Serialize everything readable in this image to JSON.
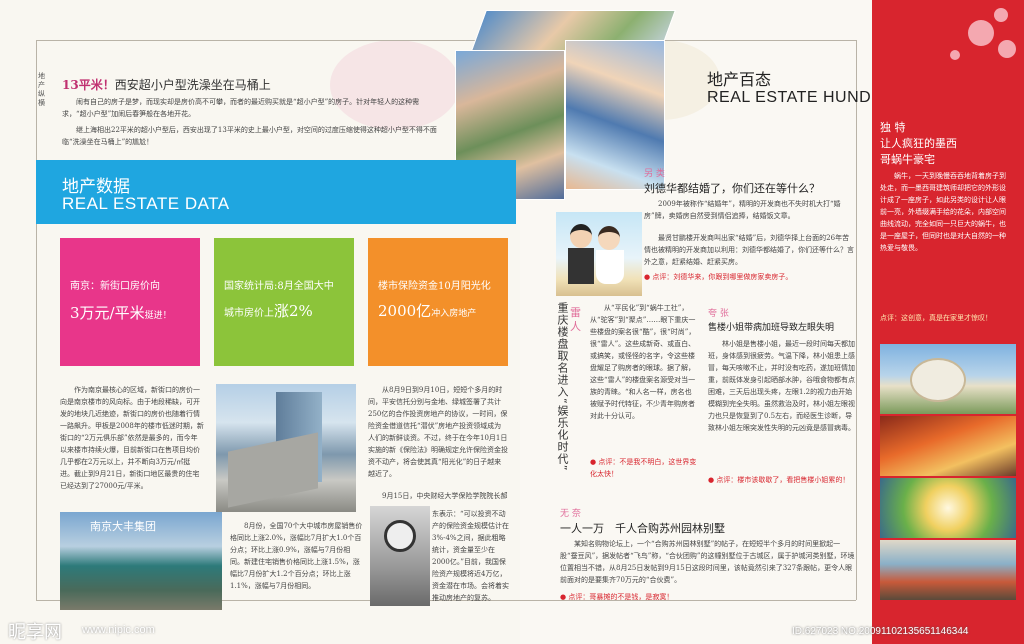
{
  "left": {
    "side_label": "地产纵横",
    "article1": {
      "headline_prefix": "13平米！",
      "headline_rest": "西安超小户型洗澡坐在马桶上",
      "para1": "闹有自己的房子是梦，而现实却是房价高不可攀，而者的最近购买就是“超小户型”的房子。针对年轻人的这种需求，“超小户型”加闹后春笋般在各地开花。",
      "para2": "继上海相出22平米的超小户型后，西安出现了13平米的史上最小户型，对空间的过度压缩使得这种超小户型不得不面临“洗澡坐在马桶上”的尴尬！"
    },
    "banner": {
      "zh": "地产数据",
      "en": "REAL ESTATE DATA"
    },
    "cards": [
      {
        "line1": "南京：新街口房价向",
        "big": "3万元/平米",
        "tail": "挺进！"
      },
      {
        "line1": "国家统计局:8月全国大中",
        "line2_pre": "城市房价上",
        "big": "涨2%",
        "tail": ""
      },
      {
        "line1": "楼市保险资金10月阳光化",
        "big": "2000亿",
        "tail": "冲入房地产"
      }
    ],
    "col1_text": "作为南京最核心的区域，新街口的房价一向是南京楼市的风向标。由于地段稀缺，可开发的地块几近绝迹，新街口的房价也随着行情一路飙升。甲板是2008年的楼市低迷时期，新街口的“2万元俱乐部”依然是最多的，而今年以来楼市持续火爆，目前新街口在售项目均价几乎都在2万元以上，并不断向3万元/㎡挺进。截止到9月21日，新街口地区最贵的住宅已经达到了27000元/平米。",
    "col3_text": "从8月9日到9月10日，短短个多月的时间，平安信托分别与金地、绿城签署了共计250亿的合作投资房地产的协议，一时间，保险资金借道信托“潜伏”房地产投资领域成为人们的新鲜谈资。不过，终于在今年10月1日实施的新《保险法》明确规定允许保险资金投资不动产，将会使其真“阳光化”的日子越来越近了。",
    "col3_text2": "9月15日，中央财经大学保险学院院长郝演苏表示：“可以预计今年年底，险资投资不动产的规模将在2000亿元左右。”目前，我国保险资产规模将近4万亿元，以投资不动产的比例上限10%计算，险资投资不动产的空间高达4000亿元。",
    "col2_text": "8月份，全国70个大中城市房屋销售价格同比上涨2.0%，涨幅比7月扩大1.0个百分点；环比上涨0.9%，涨幅与7月份相同。新建住宅销售价格同比上涨1.5%，涨幅比7月份扩大1.2个百分点；环比上涨1.1%，涨幅与7月份相同。",
    "col4_text": "东表示：“可以投资不动产的保险资金规模估计在3%-4%之间，据此粗略统计，资金量至少在2000亿。”目前，我国保险资产规模将近4万亿，资金潜在市场。会将着实推动房地产的复苏。",
    "building_sign": "南京大丰集团"
  },
  "middle": {
    "title_zh": "地产百态",
    "title_en": "REAL ESTATE HUNDRED CONDITION",
    "article_a": {
      "tag": "另 类",
      "headline": "刘德华都结婚了，你们还在等什么？",
      "para1": "2009年被称作“结婚年”，精明的开发商也不失时机大打“婚房”牌，卖婚房自然受到情侣追捧，结婚饭文章。",
      "para2": "最贤甘鹏楼开发商叫出家“结婚”后，刘德华择上台面的26年苦情也被精明的开发商加以利用：刘德华都结婚了，你们还等什么？言外之意，赶紧结婚、赶紧买房。",
      "comment": "点评：刘德华来，你跟到哪里做房家卖房子。"
    },
    "vertical_title": "重庆楼盘取名进入“娱乐化时代”",
    "article_b": {
      "tag_label": "雷",
      "tag_label2": "人",
      "text": "从“平民化”到“蜗牛工社”，从“驼客”到“聚点”……眼下重庆一些楼盘的案名很“酷”，很“时尚”，很“雷人”。这些成新奇、或直白、或搞笑，或怪怪的名字，令这些楼盘耀足了购房者的眼球。据了解，这些“雷人”的楼盘案名源受对当一族的青睐。“和人名一样，房名也被赋予时代特征，不少青年购房者对此十分认可。",
      "comment": "点评：不是我不明白，这世界变化太快！"
    },
    "article_c": {
      "tag": "夸 张",
      "headline": "售楼小姐带病加班导致左眼失明",
      "text": "林小姐是售楼小姐，最近一段时间每天都加班，身体感到很疲劳。气温下降，林小姐患上感冒，每天咳嗽不止，并时没有吃药，遂加班情加重，前既体发身引起晒部水肿，谷哦食物都有点困难，三天后出现头疼，左眼1.2的视力由开始模糊到完全失明。虽然救治及时，林小姐左眼视力也只是恢复到了0.5左右，而经医生诊断，导致林小姐左眼突发性失明的元凶竟是感冒病毒。",
      "comment": "点评：楼市该歇歇了，看把售楼小姐累的！"
    },
    "article_d": {
      "tag": "无 奈",
      "headline": "一人一万　千人合购苏州园林别墅",
      "text": "某知名购物论坛上，一个“合购苏州园林别墅”的帖子，在短短半个多月的时间里掀起一股“蚕豆风”，据发帖者“飞鸟”称，“合伙团购”的这幢别墅位于古城区，属于护城河类别墅，环境位置相当不错，从8月25日发帖到9月15日这段时间里，该帖竟然引来了327条跟帖，更令人眼前面对的是要集齐70万元的“合伙费”。",
      "comment": "点评：哥暴摊的不是钱，是寂寞！"
    }
  },
  "right": {
    "tag": "独 特",
    "headline_line1": "让人疯狂的墨西",
    "headline_line2": "哥蜗牛豪宅",
    "text": "蜗牛，一天到晚慢吞吞地背着房子到处走，而一墨西哥建筑师却把它的外形设计成了一座房子，如此另类的设计让人眼前一亮，外墙缀满手绘的花朵，内部空间曲线流动，完全如同一只巨大的蜗牛，也是一座屋子，但同时也是对大自然的一种热爱与敬畏。",
    "comment": "点评：这创意，真是在家里才惊叹！"
  },
  "watermark": {
    "logo": "昵享网",
    "site": "www.nipic.com",
    "id_text": "ID:627023 NO:20091102135651146344"
  },
  "colors": {
    "accent_blue": "#1fa6e0",
    "pink": "#e8368a",
    "green": "#8cc43a",
    "orange": "#f3902a",
    "red": "#d8252e"
  }
}
